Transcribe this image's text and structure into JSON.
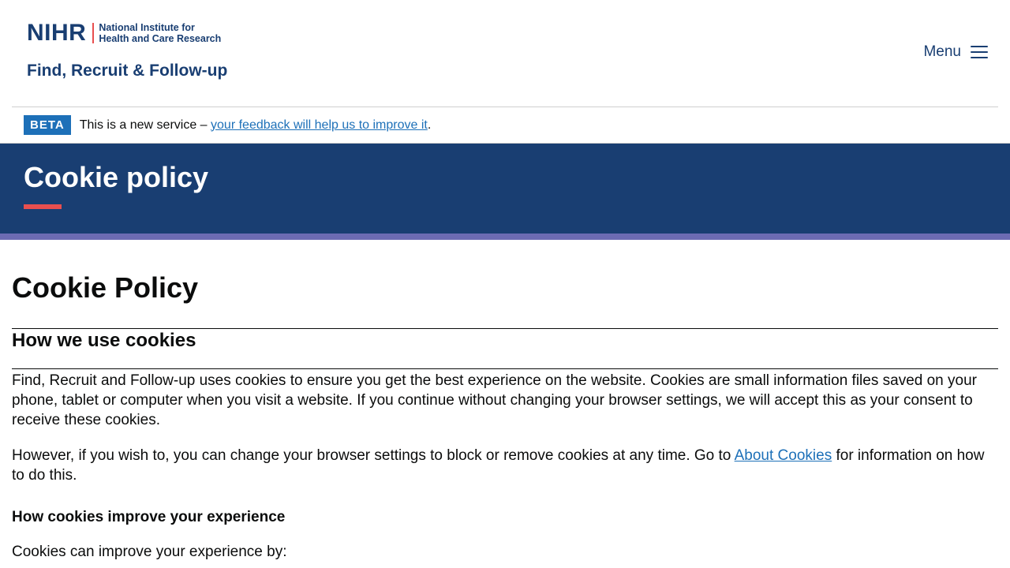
{
  "header": {
    "logo_mark": "NIHR",
    "logo_org_line1": "National Institute for",
    "logo_org_line2": "Health and Care Research",
    "service_name": "Find, Recruit & Follow-up",
    "menu_label": "Menu"
  },
  "beta": {
    "tag": "BETA",
    "text": "This is a new service –",
    "link_text": "your feedback will help us to improve it",
    "suffix": "."
  },
  "hero": {
    "title": "Cookie policy"
  },
  "main": {
    "heading": "Cookie Policy",
    "section_title": "How we use cookies",
    "para1": "Find, Recruit and Follow-up uses cookies to ensure you get the best experience on the website. Cookies are small information files saved on your phone, tablet or computer when you visit a website.  If you continue without changing your browser settings, we will accept this as your consent to receive these cookies.",
    "para2_before": "However, if you wish to, you can change your browser settings to block or remove cookies at any time. Go to",
    "para2_link": "About Cookies",
    "para2_after": "for information on how to do this.",
    "subheading": "How cookies improve your experience",
    "para3": "Cookies can improve your experience by:"
  },
  "colors": {
    "brand_navy": "#193e72",
    "accent_red": "#e84f4f",
    "stripe_purple": "#6c6bb3",
    "link_blue": "#1d70b8"
  }
}
